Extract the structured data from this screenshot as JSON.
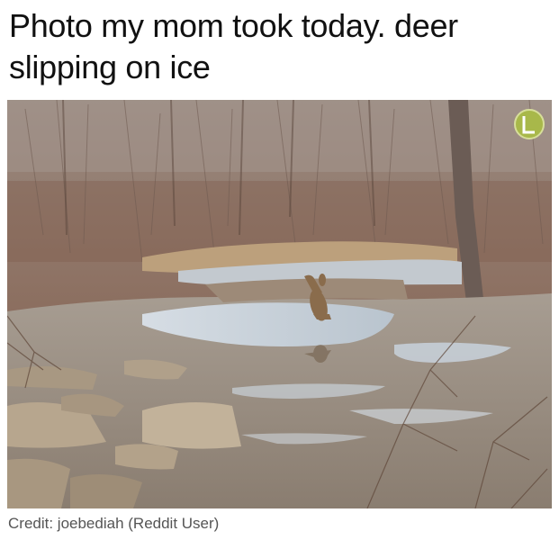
{
  "post": {
    "caption": "Photo my mom took today. deer slipping on ice",
    "credit": "Credit: joebediah (Reddit User)"
  },
  "photo": {
    "subject": "deer",
    "palette": {
      "forest": "#8a7566",
      "ice": "#c9d3dc",
      "water": "#9a938a",
      "deer": "#8a6c4c",
      "grass": "#bca07c",
      "rock": "#b7a68e"
    }
  }
}
